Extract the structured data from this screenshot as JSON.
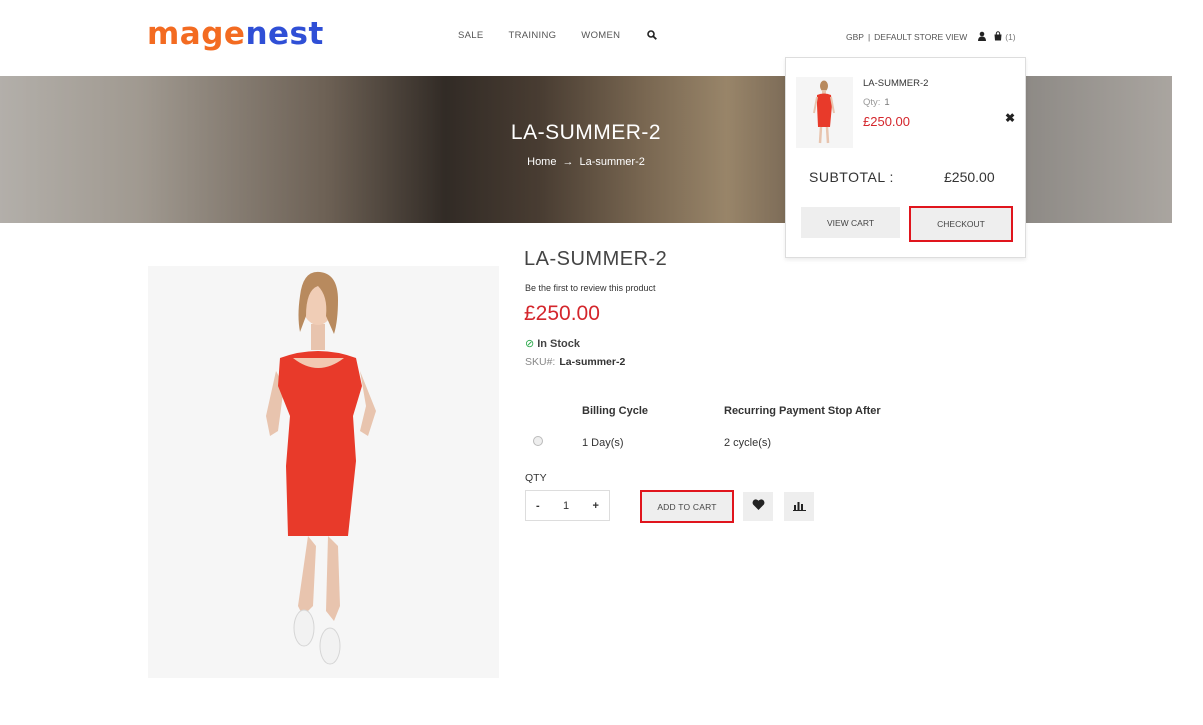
{
  "header": {
    "logo_part1": "mage",
    "logo_part2": "nest",
    "nav": {
      "sale": "SALE",
      "training": "TRAINING",
      "women": "WOMEN"
    },
    "currency": "GBP",
    "separator": "|",
    "store_view": "DEFAULT STORE VIEW",
    "cart_count": "(1)"
  },
  "banner": {
    "title": "LA-SUMMER-2",
    "crumb_home": "Home",
    "crumb_arrow": "→",
    "crumb_current": "La-summer-2"
  },
  "product": {
    "title": "LA-SUMMER-2",
    "review_link": "Be the first to review this product",
    "price": "£250.00",
    "stock": "In Stock",
    "sku_label": "SKU#:",
    "sku": "La-summer-2",
    "billing_header": "Billing Cycle",
    "recurring_header": "Recurring Payment Stop After",
    "billing_value": "1 Day(s)",
    "recurring_value": "2 cycle(s)",
    "qty_label": "QTY",
    "qty_minus": "-",
    "qty_value": "1",
    "qty_plus": "+",
    "add_to_cart": "ADD TO CART"
  },
  "minicart": {
    "item_name": "LA-SUMMER-2",
    "qty_label": "Qty:",
    "qty_value": "1",
    "item_price": "£250.00",
    "remove": "✖",
    "subtotal_label": "SUBTOTAL :",
    "subtotal_value": "£250.00",
    "view_cart": "VIEW CART",
    "checkout": "CHECKOUT"
  },
  "colors": {
    "accent_red": "#d4262c",
    "highlight_border": "#e0151d",
    "logo_orange": "#f36b21",
    "logo_blue": "#2f4fd6"
  }
}
